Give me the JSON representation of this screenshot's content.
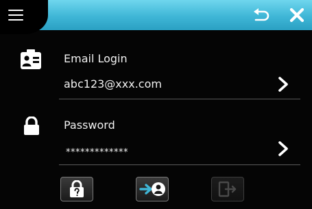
{
  "header": {
    "menu_icon": "hamburger-menu-icon",
    "back_icon": "back-arrow-icon",
    "close_icon": "close-x-icon",
    "accent_color": "#3fb6d6"
  },
  "email": {
    "icon": "id-card-icon",
    "label": "Email Login",
    "value": "abc123@xxx.com"
  },
  "password": {
    "icon": "padlock-icon",
    "label": "Password",
    "value": "*************"
  },
  "buttons": [
    {
      "icon": "lock-question-icon",
      "enabled": true
    },
    {
      "icon": "login-arrow-user-icon",
      "enabled": true
    },
    {
      "icon": "logout-door-icon",
      "enabled": false
    }
  ]
}
